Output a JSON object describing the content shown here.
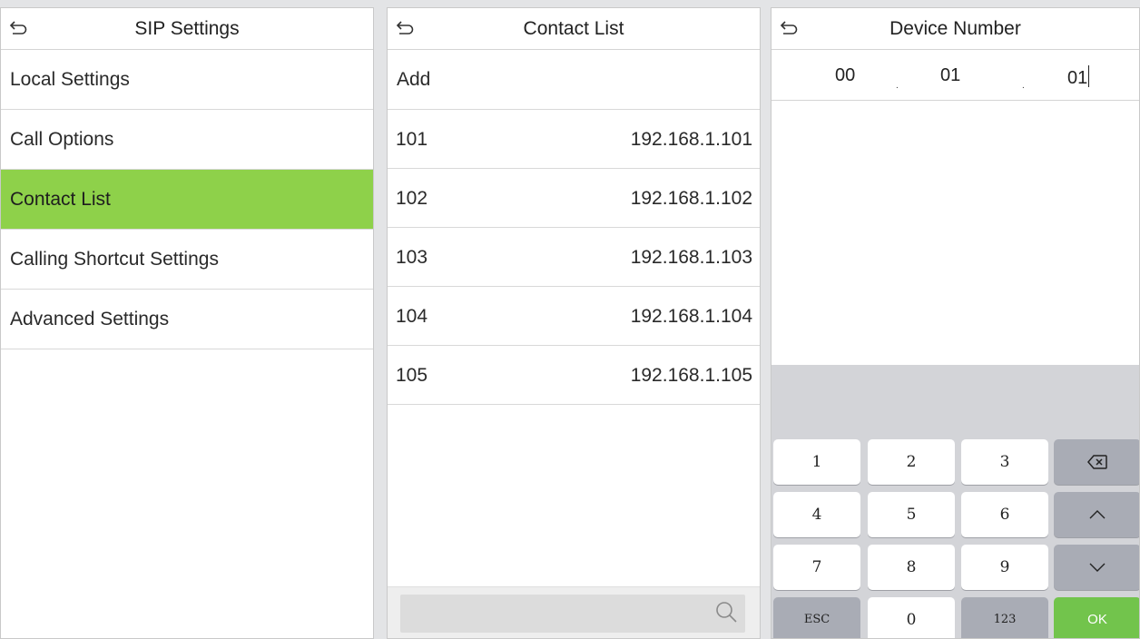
{
  "sip_panel": {
    "title": "SIP Settings",
    "items": [
      {
        "label": "Local Settings"
      },
      {
        "label": "Call Options"
      },
      {
        "label": "Contact List",
        "active": true
      },
      {
        "label": "Calling Shortcut Settings"
      },
      {
        "label": "Advanced Settings"
      }
    ]
  },
  "contact_panel": {
    "title": "Contact List",
    "add_label": "Add",
    "contacts": [
      {
        "number": "101",
        "ip": "192.168.1.101"
      },
      {
        "number": "102",
        "ip": "192.168.1.102"
      },
      {
        "number": "103",
        "ip": "192.168.1.103"
      },
      {
        "number": "104",
        "ip": "192.168.1.104"
      },
      {
        "number": "105",
        "ip": "192.168.1.105"
      }
    ],
    "search": {
      "placeholder": "",
      "icon": "search-icon"
    }
  },
  "device_panel": {
    "title": "Device Number",
    "segments": [
      "00",
      "01",
      "01"
    ],
    "separator": ".",
    "keyboard": {
      "keys": [
        "1",
        "2",
        "3",
        "4",
        "5",
        "6",
        "7",
        "8",
        "9",
        "0"
      ],
      "esc": "ESC",
      "mode": "123",
      "ok": "OK",
      "backspace_icon": "backspace-icon",
      "up_icon": "chevron-up-icon",
      "down_icon": "chevron-down-icon"
    }
  },
  "colors": {
    "active_item": "#8ed14a",
    "ok_key": "#72c44c",
    "keyboard_bg": "#d3d4d8",
    "function_key": "#a9acb5"
  }
}
